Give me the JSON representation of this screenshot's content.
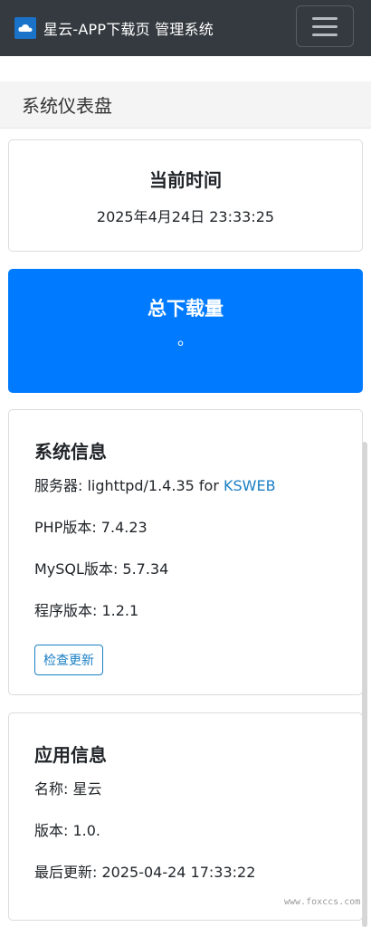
{
  "navbar": {
    "brand": "星云-APP下载页 管理系统",
    "logo_icon": "cloud-logo-icon",
    "menu_icon": "hamburger-menu-icon"
  },
  "page": {
    "title": "系统仪表盘"
  },
  "time_card": {
    "title": "当前时间",
    "value": "2025年4月24日 23:33:25"
  },
  "download_card": {
    "title": "总下载量",
    "value": "。",
    "color": "#007bff"
  },
  "system_info": {
    "title": "系统信息",
    "server_label": "服务器: lighttpd/1.4.35 for ",
    "server_link": "KSWEB",
    "php": "PHP版本: 7.4.23",
    "mysql": "MySQL版本: 5.7.34",
    "program": "程序版本: 1.2.1",
    "check_update": "检查更新"
  },
  "app_info": {
    "title": "应用信息",
    "name": "名称: 星云",
    "version": "版本: 1.0.",
    "updated": "最后更新: 2025-04-24 17:33:22"
  },
  "watermark": "www.foxccs.com"
}
